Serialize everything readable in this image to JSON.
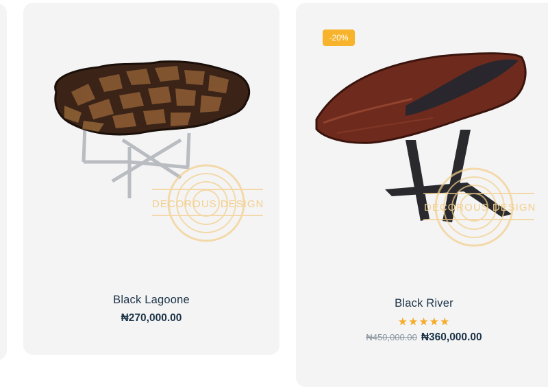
{
  "products": [
    {
      "name": "Black Lagoone",
      "price": "₦270,000.00",
      "watermark": "DECOROUS DESIGN"
    },
    {
      "name": "Black River",
      "badge": "-20%",
      "rating": 5,
      "rating_stars": "★★★★★",
      "old_price": "₦450,000.00",
      "price": "₦360,000.00",
      "watermark": "DECOROUS DESIGN"
    }
  ],
  "colors": {
    "card_bg": "#f4f4f5",
    "text": "#1c3347",
    "badge": "#f7b32b",
    "stars": "#f5ac2b",
    "old_price": "#8a96a0"
  }
}
